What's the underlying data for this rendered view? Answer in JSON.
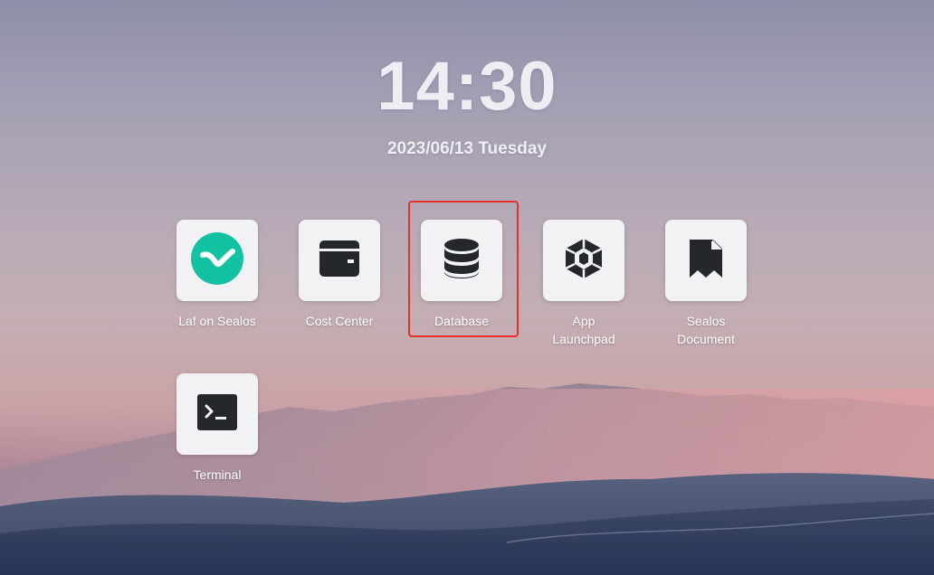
{
  "clock": {
    "time": "14:30",
    "date": "2023/06/13 Tuesday"
  },
  "apps": [
    {
      "label": "Laf on Sealos",
      "icon": "laf-logo-icon",
      "icon_color": "#13c2a3"
    },
    {
      "label": "Cost Center",
      "icon": "wallet-icon",
      "icon_color": "#24282c"
    },
    {
      "label": "Database",
      "icon": "database-icon",
      "icon_color": "#24282c"
    },
    {
      "label": "App Launchpad",
      "icon": "hexagon-gem-icon",
      "icon_color": "#24282c"
    },
    {
      "label": "Sealos Document",
      "icon": "bookmark-document-icon",
      "icon_color": "#24282c"
    },
    {
      "label": "Terminal",
      "icon": "terminal-icon",
      "icon_color": "#24282c"
    }
  ],
  "highlight": {
    "target": "Database",
    "color": "#e8302a"
  }
}
